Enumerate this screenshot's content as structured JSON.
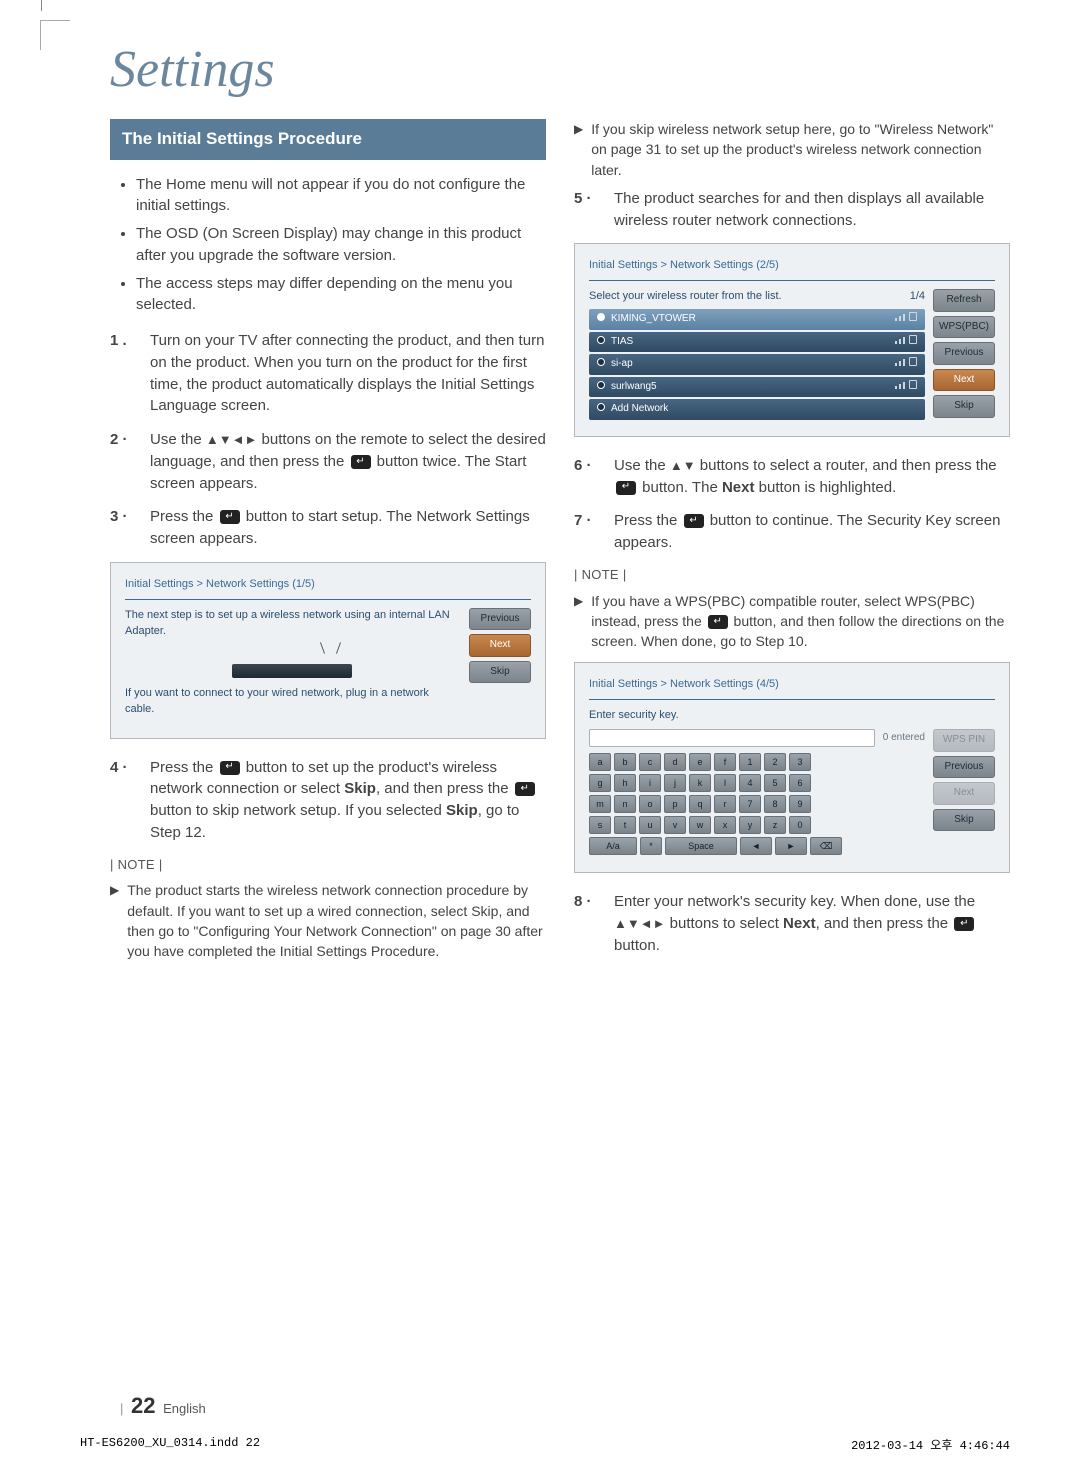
{
  "page_title": "Settings",
  "section_header": "The Initial Settings Procedure",
  "left_bullets": [
    "The Home menu will not appear if you do not configure the initial settings.",
    "The OSD (On Screen Display) may change in this product after you upgrade the software version.",
    "The access steps may differ depending on the menu you selected."
  ],
  "steps": {
    "s1": {
      "num": "1 .",
      "text": "Turn on your TV after connecting the product, and then turn on the product. When you turn on the product for the first time, the product automatically displays the Initial Settings Language screen."
    },
    "s2": {
      "num": "2 ·",
      "pre": "Use the ",
      "arrows": "▲▼◄►",
      "mid": " buttons on the remote to select the desired language, and then press the ",
      "post": " button twice. The Start screen appears."
    },
    "s3": {
      "num": "3 ·",
      "pre": "Press the ",
      "post": " button to start setup. The Network Settings screen appears."
    },
    "s4": {
      "num": "4 ·",
      "pre": "Press the ",
      "mid": " button to set up the product's wireless network connection or select ",
      "skip": "Skip",
      "mid2": ", and then press the ",
      "post": " button to skip network setup. If you selected ",
      "skip2": "Skip",
      "post2": ", go to Step 12."
    },
    "s5": {
      "num": "5 ·",
      "text": "The product searches for and then displays all available wireless router network connections."
    },
    "s6": {
      "num": "6 ·",
      "pre": "Use the ",
      "arrows": "▲▼",
      "mid": " buttons to select a router, and then press the ",
      "post": " button. The ",
      "next": "Next",
      "post2": " button is highlighted."
    },
    "s7": {
      "num": "7 ·",
      "pre": "Press the ",
      "post": " button to continue. The Security Key screen appears."
    },
    "s8": {
      "num": "8 ·",
      "pre": "Enter your network's security key. When done, use the ",
      "arrows": "▲▼◄►",
      "mid": " buttons to select ",
      "next": "Next",
      "mid2": ", and then press the ",
      "post": " button."
    }
  },
  "note_label": "NOTE",
  "left_notes": [
    "The product starts the wireless network connection procedure by default. If you want to set up a wired connection, select Skip, and then go to \"Configuring Your Network Connection\" on page 30 after you have completed the Initial Settings Procedure.",
    "If you skip wireless network setup here, go to \"Wireless Network\" on page 31 to set up the product's wireless network connection later."
  ],
  "right_notes": [
    "If you have a WPS(PBC) compatible router, select WPS(PBC) instead, press the  button, and then follow the directions on the screen. When done, go to Step 10."
  ],
  "ss1": {
    "crumb": "Initial Settings > Network Settings (1/5)",
    "line1": "The next step is to set up a wireless network using an internal LAN Adapter.",
    "line2": "If you want to connect to your wired network, plug in a network cable.",
    "buttons": {
      "prev": "Previous",
      "next": "Next",
      "skip": "Skip"
    }
  },
  "ss2": {
    "crumb": "Initial Settings > Network Settings (2/5)",
    "prompt": "Select your wireless router from the list.",
    "page": "1/4",
    "routers": [
      "KIMING_VTOWER",
      "TIAS",
      "si-ap",
      "surlwang5",
      "Add Network"
    ],
    "buttons": {
      "refresh": "Refresh",
      "wps": "WPS(PBC)",
      "prev": "Previous",
      "next": "Next",
      "skip": "Skip"
    }
  },
  "ss3": {
    "crumb": "Initial Settings > Network Settings (4/5)",
    "prompt": "Enter security key.",
    "entered": "0 entered",
    "buttons": {
      "wpspin": "WPS PIN",
      "prev": "Previous",
      "next": "Next",
      "skip": "Skip"
    },
    "rows": [
      [
        "a",
        "b",
        "c",
        "d",
        "e",
        "f",
        "1",
        "2",
        "3"
      ],
      [
        "g",
        "h",
        "i",
        "j",
        "k",
        "l",
        "4",
        "5",
        "6"
      ],
      [
        "m",
        "n",
        "o",
        "p",
        "q",
        "r",
        "7",
        "8",
        "9"
      ],
      [
        "s",
        "t",
        "u",
        "v",
        "w",
        "x",
        "y",
        "z",
        "0"
      ]
    ],
    "bottom": {
      "aa": "A/a",
      "star": "*",
      "space": "Space",
      "left": "◄",
      "right": "►",
      "back": "⌫"
    }
  },
  "page_footer": {
    "num": "22",
    "lang": "English",
    "bar": "|"
  },
  "doc_footer": {
    "file": "HT-ES6200_XU_0314.indd   22",
    "stamp": "2012-03-14   오후 4:46:44"
  }
}
